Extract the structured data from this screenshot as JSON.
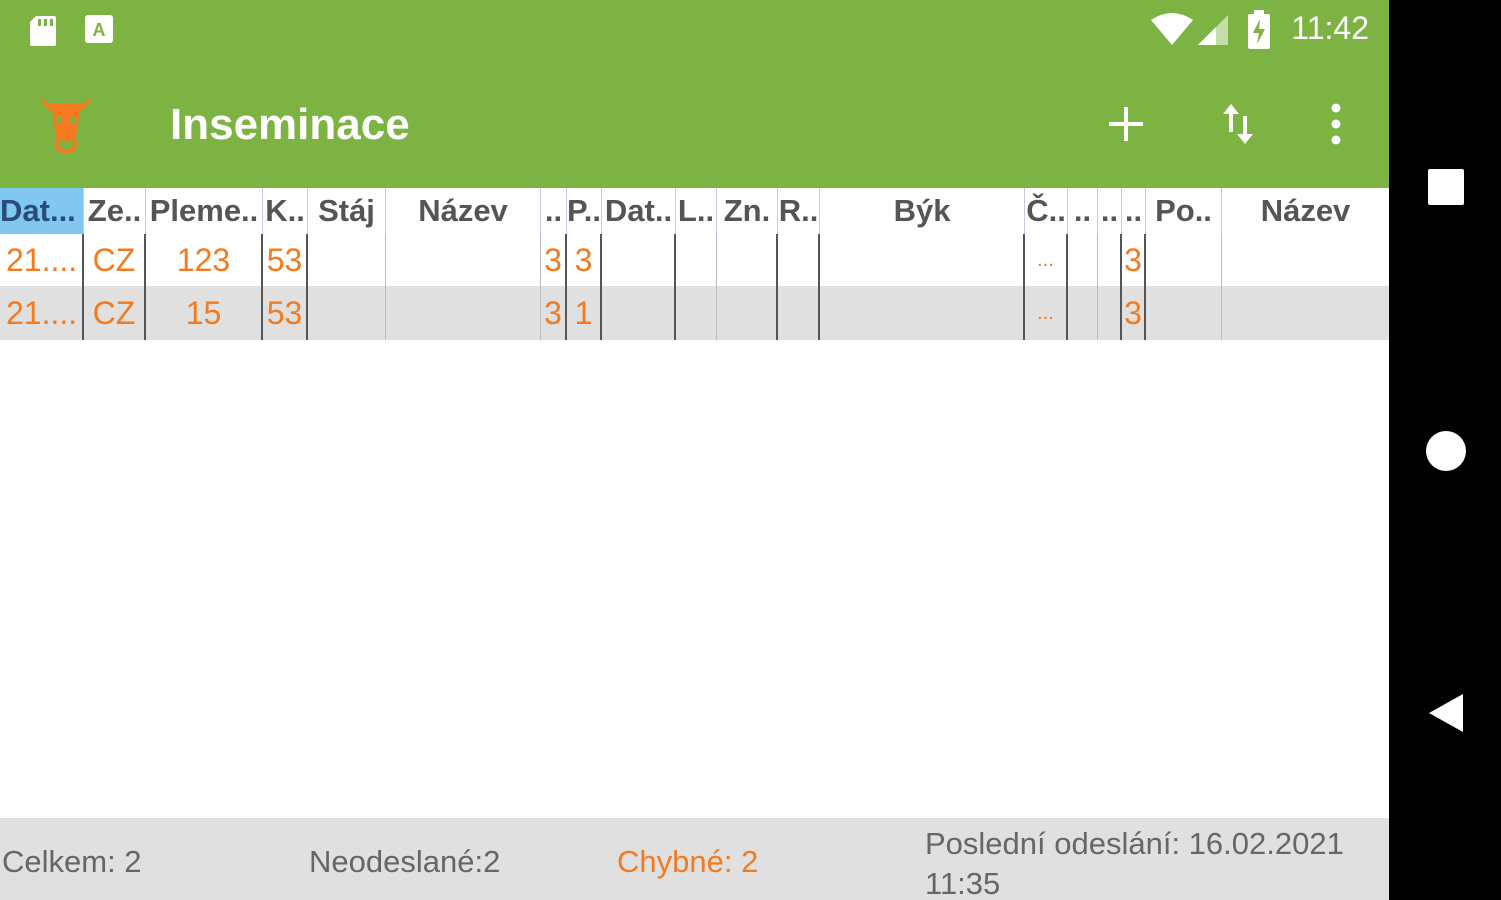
{
  "status_bar": {
    "time": "11:42",
    "icons": [
      "sd-card-icon",
      "a-notification-icon",
      "wifi-icon",
      "signal-icon",
      "battery-charging-icon"
    ]
  },
  "app_bar": {
    "title": "Inseminace",
    "logo": "bull-head-icon",
    "actions": [
      "add-icon",
      "sort-icon",
      "more-vert-icon"
    ]
  },
  "table": {
    "headers": [
      "Dat...",
      "Ze..",
      "Pleme..",
      "K..",
      "Stáj",
      "Název",
      "..",
      "P..",
      "Dat..",
      "L..",
      "Zn.",
      "R..",
      "Býk",
      "Č..",
      "..",
      "..",
      "..",
      "Po..",
      "Název"
    ],
    "rows": [
      [
        "21....",
        "CZ",
        "123",
        "53",
        "",
        "",
        "3",
        "3",
        "",
        "",
        "",
        "",
        "",
        "...",
        "",
        "",
        "3",
        "",
        ""
      ],
      [
        "21....",
        "CZ",
        "15",
        "53",
        "",
        "",
        "3",
        "1",
        "",
        "",
        "",
        "",
        "",
        "...",
        "",
        "",
        "3",
        "",
        ""
      ]
    ]
  },
  "footer": {
    "total": "Celkem: 2",
    "unsent": "Neodeslané:2",
    "errors": "Chybné: 2",
    "last_sent_line1": "Poslední odeslání: 16.02.2021",
    "last_sent_line2": "11:35"
  },
  "colors": {
    "primary": "#7cb342",
    "accent": "#f37a1f",
    "header_highlight": "#81c7f0"
  },
  "nav_bar": [
    "recents-square-icon",
    "home-circle-icon",
    "back-triangle-icon"
  ]
}
